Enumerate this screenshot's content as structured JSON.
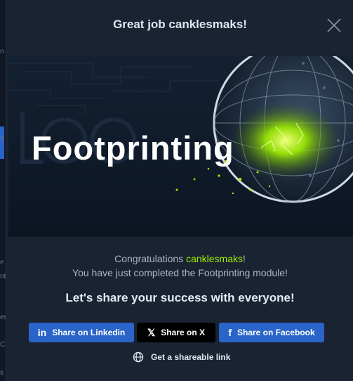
{
  "underlay": {
    "fragments": [
      "n",
      "n",
      "e",
      "nt",
      "es",
      "C",
      "s"
    ]
  },
  "modal": {
    "title": "Great job canklesmaks!",
    "banner_title": "Footprinting",
    "congrats_prefix": "Congratulations ",
    "username": "canklesmaks",
    "congrats_suffix": "!",
    "completed_text": "You have just completed the Footprinting module!",
    "share_heading": "Let's share your success with everyone!",
    "buttons": {
      "linkedin": "Share on Linkedin",
      "x": "Share on X",
      "facebook": "Share on Facebook"
    },
    "share_link": "Get a shareable link"
  },
  "colors": {
    "accent_green": "#9fef00",
    "button_blue": "#2a64c9",
    "modal_bg": "#1a2332"
  },
  "icons": [
    "close-icon",
    "linkedin-icon",
    "x-logo-icon",
    "facebook-icon",
    "globe-icon"
  ]
}
